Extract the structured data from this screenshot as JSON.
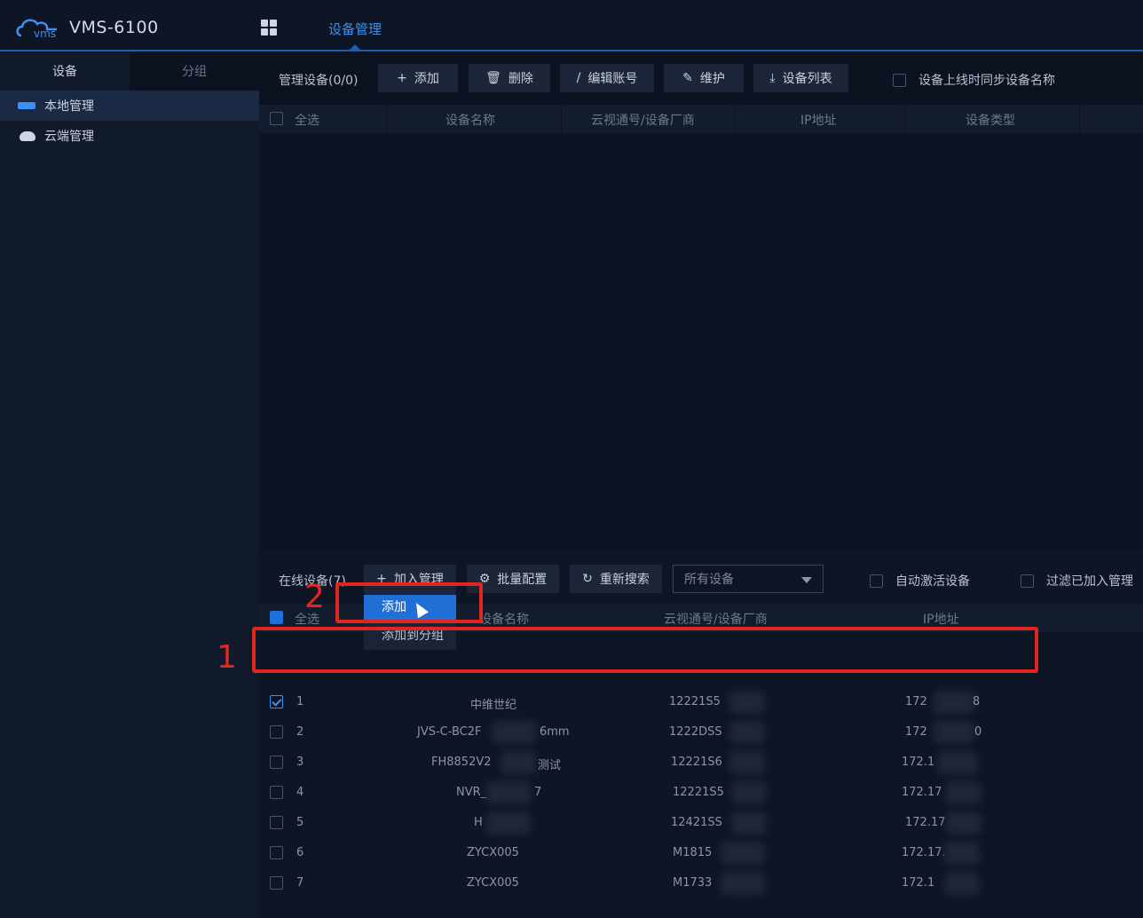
{
  "header": {
    "app_title": "VMS-6100",
    "logo_text": "vms",
    "active_tab": "设备管理"
  },
  "sidebar": {
    "tabs": [
      "设备",
      "分组"
    ],
    "items": [
      {
        "label": "本地管理",
        "icon": "local-device-icon"
      },
      {
        "label": "云端管理",
        "icon": "cloud-icon"
      }
    ]
  },
  "managed": {
    "label": "管理设备(0/0)",
    "buttons": {
      "add": "添加",
      "delete": "删除",
      "edit_account": "编辑账号",
      "maintain": "维护",
      "device_list": "设备列表"
    },
    "sync_name_option": "设备上线时同步设备名称",
    "columns": [
      "全选",
      "设备名称",
      "云视通号/设备厂商",
      "IP地址",
      "设备类型"
    ]
  },
  "online": {
    "label": "在线设备(7)",
    "buttons": {
      "join_manage": "加入管理",
      "batch_config": "批量配置",
      "rescan": "重新搜索"
    },
    "filter_selected": "所有设备",
    "auto_activate": "自动激活设备",
    "filter_added": "过滤已加入管理",
    "columns": [
      "全选",
      "设备名称",
      "云视通号/设备厂商",
      "IP地址"
    ],
    "rows": [
      {
        "no": "1",
        "name": "中维世纪",
        "id": "12221S5",
        "ip": "172",
        "ip_tail": "8",
        "checked": true
      },
      {
        "no": "2",
        "name": "JVS-C-BC2F",
        "name_tail": "6mm",
        "id": "1222DSS",
        "ip": "172",
        "ip_tail": "0",
        "checked": false
      },
      {
        "no": "3",
        "name": "FH8852V2",
        "name_tail": "测试",
        "id": "12221S6",
        "ip": "172.1",
        "checked": false
      },
      {
        "no": "4",
        "name": "NVR_",
        "name_tail": "7",
        "id": "12221S5",
        "ip": "172.17",
        "checked": false
      },
      {
        "no": "5",
        "name": "H",
        "id": "12421SS",
        "ip": "172.17",
        "checked": false
      },
      {
        "no": "6",
        "name": "ZYCX005",
        "id": "M1815",
        "ip": "172.17.",
        "checked": false
      },
      {
        "no": "7",
        "name": "ZYCX005",
        "id": "M1733",
        "ip": "172.1",
        "checked": false
      }
    ]
  },
  "dropdown": {
    "items": [
      "添加",
      "添加到分组"
    ]
  },
  "annotations": {
    "step1": "1",
    "step2": "2"
  },
  "colors": {
    "accent": "#1f6fd6",
    "annotation": "#e0261f",
    "background": "#0b1220"
  }
}
